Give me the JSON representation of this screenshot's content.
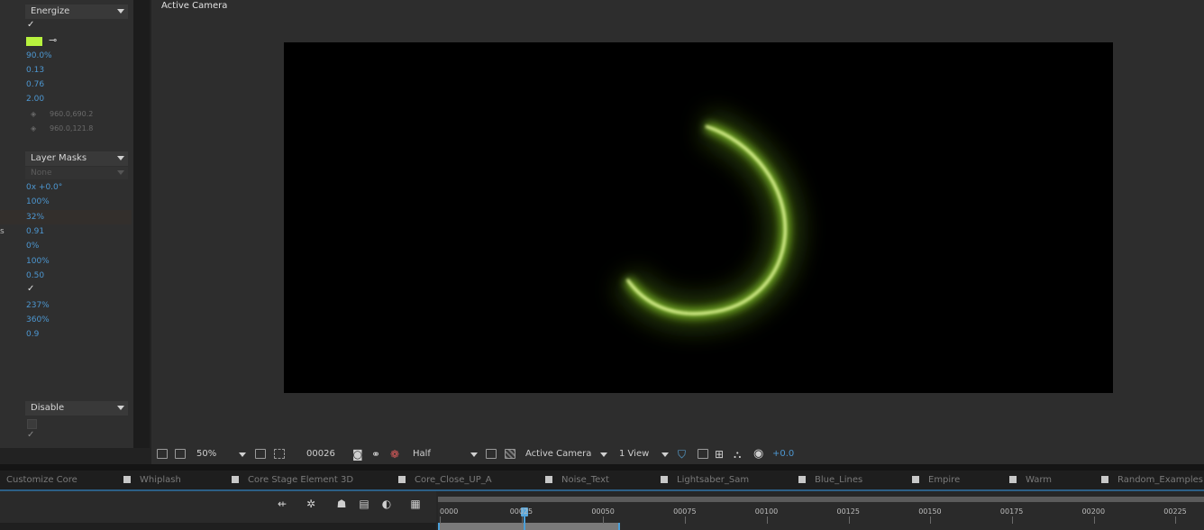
{
  "left_panel": {
    "dropdown_energize": "Energize",
    "swatch_color": "#b8f23e",
    "values_a": [
      "90.0%",
      "0.13",
      "0.76",
      "2.00"
    ],
    "coord1": "960.0,690.2",
    "coord2": "960.0,121.8",
    "dropdown_layer_masks": "Layer Masks",
    "layer_masks_sub": "None",
    "values_b": [
      "0x +0.0°",
      "100%",
      "32%",
      "0.91",
      "0%",
      "100%",
      "0.50"
    ],
    "values_c": [
      "237%",
      "360%",
      "0.9"
    ],
    "dropdown_disable": "Disable",
    "check_mark": "✓",
    "edge_letter": "s"
  },
  "viewer": {
    "label": "Active Camera",
    "glow_color": "#a6e83a"
  },
  "viewer_toolbar": {
    "zoom": "50%",
    "frame": "00026",
    "resolution": "Half",
    "camera": "Active Camera",
    "views": "1 View",
    "exposure": "+0.0"
  },
  "tabs": [
    "Customize Core",
    "Whiplash",
    "Core Stage Element 3D",
    "Core_Close_UP_A",
    "Noise_Text",
    "Lightsaber_Sam",
    "Blue_Lines",
    "Empire",
    "Warm",
    "Random_Examples"
  ],
  "timeline": {
    "ruler_labels": [
      "0000",
      "00025",
      "00050",
      "00075",
      "00100",
      "00125",
      "00150",
      "00175",
      "00200",
      "00225"
    ],
    "current_frame": 26
  }
}
